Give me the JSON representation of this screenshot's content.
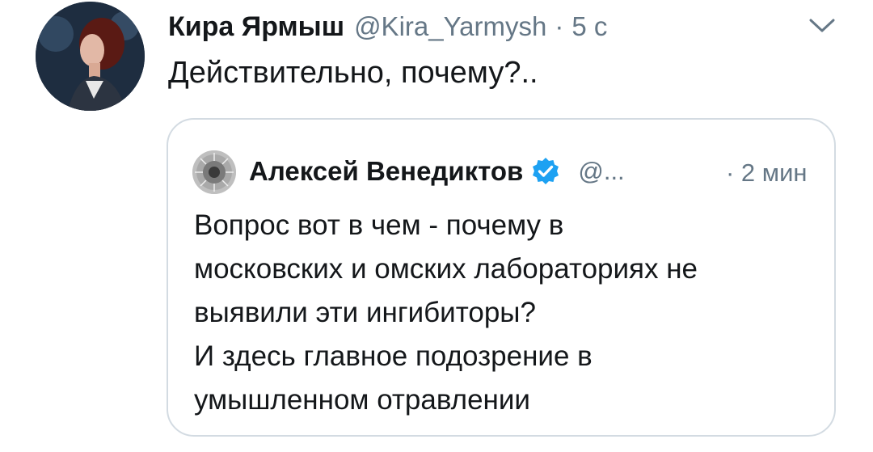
{
  "tweet": {
    "author_name": "Кира Ярмыш",
    "author_handle": "@Kira_Yarmysh",
    "separator": "·",
    "time": "5 с",
    "text": "Действительно, почему?..",
    "avatar_icon": "profile-photo"
  },
  "quoted_tweet": {
    "author_name": "Алексей Венедиктов",
    "author_handle": "@...",
    "time": "· 2 мин",
    "verified": true,
    "verified_color": "#1da1f2",
    "text_lines": [
      "Вопрос вот в чем - почему в",
      "московских и омских лабораториях не",
      "выявили эти ингибиторы?",
      "И здесь главное подозрение в",
      "умышленном отравлении"
    ]
  },
  "colors": {
    "text_primary": "#14171a",
    "text_secondary": "#657786",
    "border": "#d3dbe2"
  }
}
